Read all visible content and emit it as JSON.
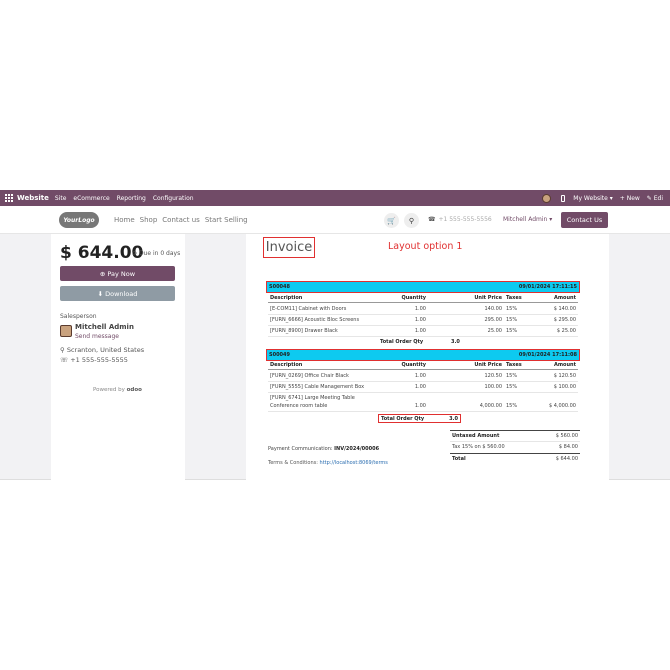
{
  "topbar": {
    "brand": "Website",
    "menus": [
      "Site",
      "eCommerce",
      "Reporting",
      "Configuration"
    ],
    "my_website": "My Website ▾",
    "new": "+ New",
    "edit": "✎ Edi"
  },
  "header": {
    "logo_text": "YourLogo",
    "nav": [
      "Home",
      "Shop",
      "Contact us",
      "Start Selling"
    ],
    "phone": "+1 555-555-5556",
    "user": "Mitchell Admin ▾",
    "contact_button": "Contact Us"
  },
  "summary": {
    "amount": "$ 644.00",
    "due": "Due in 0 days",
    "pay_button": "Pay Now",
    "download_button": "Download",
    "salesperson_label": "Salesperson",
    "salesperson_name": "Mitchell Admin",
    "send_message": "Send message",
    "location": "Scranton, United States",
    "phone": "+1 555-555-5555",
    "powered_prefix": "Powered by",
    "powered_brand": "odoo"
  },
  "invoice": {
    "title": "Invoice",
    "layout_note": "Layout option 1",
    "columns": [
      "Description",
      "Quantity",
      "Unit Price",
      "Taxes",
      "Amount"
    ],
    "sections": [
      {
        "ref": "S00048",
        "date": "09/01/2024 17:11:15",
        "rows": [
          {
            "desc": "[E-COM11] Cabinet with Doors",
            "qty": "1.00",
            "price": "140.00",
            "tax": "15%",
            "amount": "$ 140.00"
          },
          {
            "desc": "[FURN_6666] Acoustic Bloc Screens",
            "qty": "1.00",
            "price": "295.00",
            "tax": "15%",
            "amount": "$ 295.00"
          },
          {
            "desc": "[FURN_8900] Drawer Black",
            "qty": "1.00",
            "price": "25.00",
            "tax": "15%",
            "amount": "$ 25.00"
          }
        ],
        "total_qty_label": "Total Order Qty",
        "total_qty": "3.0"
      },
      {
        "ref": "S00049",
        "date": "09/01/2024 17:11:08",
        "rows": [
          {
            "desc": "[FURN_0269] Office Chair Black",
            "qty": "1.00",
            "price": "120.50",
            "tax": "15%",
            "amount": "$ 120.50"
          },
          {
            "desc": "[FURN_5555] Cable Management Box",
            "qty": "1.00",
            "price": "100.00",
            "tax": "15%",
            "amount": "$ 100.00"
          },
          {
            "desc": "[FURN_6741] Large Meeting Table",
            "desc2": "Conference room table",
            "qty": "1.00",
            "price": "4,000.00",
            "tax": "15%",
            "amount": "$ 4,000.00"
          }
        ],
        "total_qty_label": "Total Order Qty",
        "total_qty": "3.0"
      }
    ],
    "untaxed_label": "Untaxed Amount",
    "untaxed": "$ 560.00",
    "tax_label": "Tax 15% on $ 560.00",
    "tax": "$ 84.00",
    "total_label": "Total",
    "total": "$ 644.00",
    "payment_comm_label": "Payment Communication:",
    "payment_comm": "INV/2024/00006",
    "terms_label": "Terms & Conditions:",
    "terms_link": "http://localhost:8069/terms"
  },
  "colors": {
    "brand": "#714b67",
    "accent": "#0dcaf0",
    "highlight": "#e03030"
  }
}
